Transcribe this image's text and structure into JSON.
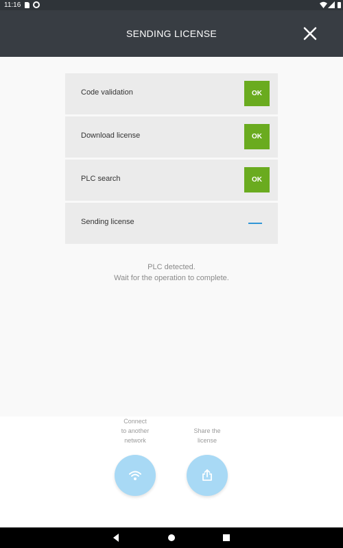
{
  "status_bar": {
    "time": "11:16"
  },
  "app_bar": {
    "title": "SENDING LICENSE"
  },
  "steps": [
    {
      "label": "Code validation",
      "status": "OK"
    },
    {
      "label": "Download license",
      "status": "OK"
    },
    {
      "label": "PLC search",
      "status": "OK"
    },
    {
      "label": "Sending license",
      "status": ""
    }
  ],
  "message": {
    "line1": "PLC detected.",
    "line2": "Wait for the operation to complete."
  },
  "actions": {
    "connect": {
      "line1": "Connect",
      "line2": "to another",
      "line3": "network",
      "icon": "wifi-icon"
    },
    "share": {
      "line1": "Share the",
      "line2": "license",
      "icon": "share-icon"
    }
  },
  "colors": {
    "app_bar": "#383d43",
    "ok_badge": "#6aab1f",
    "progress": "#2f95d6",
    "action_circle": "#a8d9f5"
  }
}
